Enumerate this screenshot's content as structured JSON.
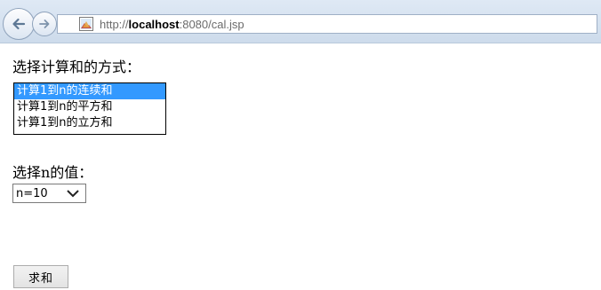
{
  "browser": {
    "url_prefix": "http://",
    "url_host": "localhost",
    "url_rest": ":8080/cal.jsp"
  },
  "form": {
    "method_label": "选择计算和的方式：",
    "method_options": [
      "计算1到n的连续和",
      "计算1到n的平方和",
      "计算1到n的立方和"
    ],
    "n_label": "选择n的值：",
    "n_selected": "n=10",
    "submit_label": "求和"
  },
  "colors": {
    "selection": "#3399ff"
  }
}
